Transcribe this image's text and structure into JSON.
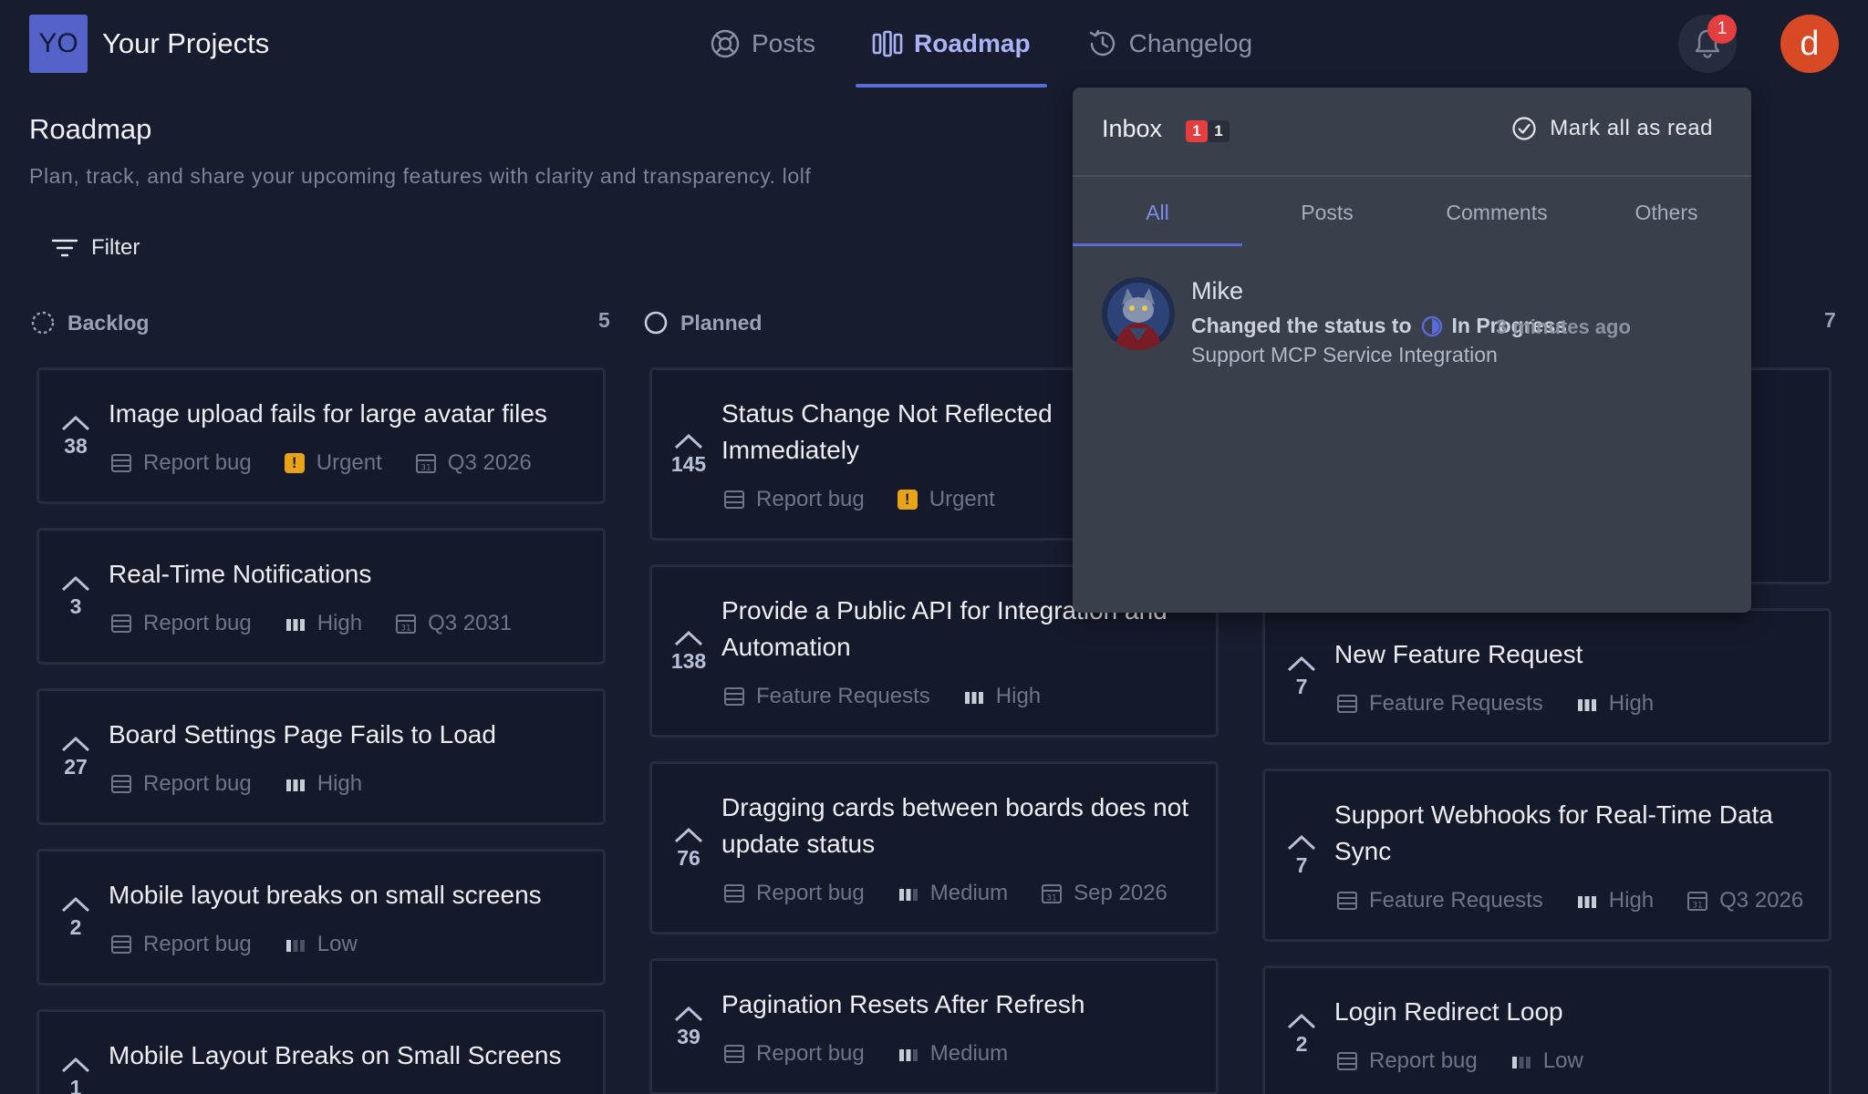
{
  "header": {
    "logo_text": "YO",
    "project_name": "Your Projects",
    "nav": [
      {
        "label": "Posts",
        "icon": "posts-icon",
        "active": false
      },
      {
        "label": "Roadmap",
        "icon": "roadmap-icon",
        "active": true
      },
      {
        "label": "Changelog",
        "icon": "history-icon",
        "active": false
      }
    ],
    "notification_count": "1",
    "user_initial": "d",
    "user_color": "#d84a26"
  },
  "page": {
    "title": "Roadmap",
    "subtitle": "Plan, track, and share your upcoming features with clarity and transparency. lolf",
    "filter_label": "Filter"
  },
  "columns": [
    {
      "label": "Backlog",
      "count": "5",
      "icon": "dashed-circle-icon",
      "cards": [
        {
          "votes": "38",
          "title": "Image upload fails for large avatar files",
          "board": "Report bug",
          "priority": "Urgent",
          "date": "Q3 2026"
        },
        {
          "votes": "3",
          "title": "Real-Time Notifications",
          "board": "Report bug",
          "priority": "High",
          "date": "Q3 2031"
        },
        {
          "votes": "27",
          "title": "Board Settings Page Fails to Load",
          "board": "Report bug",
          "priority": "High"
        },
        {
          "votes": "2",
          "title": "Mobile layout breaks on small screens",
          "board": "Report bug",
          "priority": "Low"
        },
        {
          "votes": "1",
          "title": "Mobile Layout Breaks on Small Screens"
        }
      ]
    },
    {
      "label": "Planned",
      "icon": "circle-icon",
      "cards": [
        {
          "votes": "145",
          "title": "Status Change Not Reflected Immediately",
          "board": "Report bug",
          "priority": "Urgent"
        },
        {
          "votes": "138",
          "title": "Provide a Public API for Integration and Automation",
          "board": "Feature Requests",
          "priority": "High"
        },
        {
          "votes": "76",
          "title": "Dragging cards between boards does not update status",
          "board": "Report bug",
          "priority": "Medium",
          "date": "Sep 2026"
        },
        {
          "votes": "39",
          "title": "Pagination Resets After Refresh",
          "board": "Report bug",
          "priority": "Medium"
        }
      ]
    },
    {
      "count": "7",
      "cards": [
        {
          "votes": "7",
          "title": "New Feature Request",
          "board": "Feature Requests",
          "priority": "High"
        },
        {
          "votes": "7",
          "title": "Support Webhooks for Real-Time Data Sync",
          "board": "Feature Requests",
          "priority": "High",
          "date": "Q3 2026"
        },
        {
          "votes": "2",
          "title": "Login Redirect Loop",
          "board": "Report bug",
          "priority": "Low"
        }
      ]
    }
  ],
  "inbox": {
    "title": "Inbox",
    "badge_unread": "1",
    "badge_total": "1",
    "mark_all_label": "Mark all as read",
    "tabs": [
      "All",
      "Posts",
      "Comments",
      "Others"
    ],
    "active_tab": "All",
    "notifications": [
      {
        "actor": "Mike",
        "action": "Changed the status to",
        "status": "In Progress",
        "time": "3 minutes ago",
        "target": "Support MCP Service Integration"
      }
    ]
  },
  "colors": {
    "background": "#171c2e",
    "accent": "#5a6ad8",
    "urgent": "#e8a317",
    "badge": "#e53e3e"
  }
}
